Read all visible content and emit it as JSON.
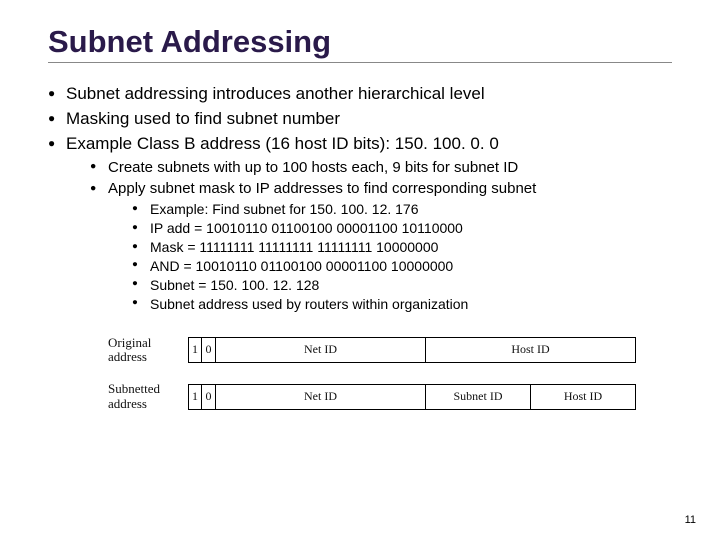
{
  "title": "Subnet Addressing",
  "bullets": {
    "b1": "Subnet addressing introduces another hierarchical level",
    "b2": "Masking used to find subnet number",
    "b3": "Example Class B address (16 host ID bits): 150. 100. 0. 0",
    "b3_1": "Create subnets with up to 100 hosts each, 9 bits for subnet ID",
    "b3_2": "Apply subnet mask to IP addresses to find corresponding subnet",
    "b3_2_1": "Example:  Find subnet for 150. 100. 12. 176",
    "b3_2_2": "IP add = 10010110 01100100 00001100 10110000",
    "b3_2_3": "Mask   = 11111111 11111111 11111111 10000000",
    "b3_2_4": "AND    = 10010110 01100100 00001100 10000000",
    "b3_2_5": "Subnet = 150. 100. 12. 128",
    "b3_2_6": "Subnet address used by routers within organization"
  },
  "diagram": {
    "row1_label": "Original address",
    "row2_label": "Subnetted address",
    "bit1": "1",
    "bit0": "0",
    "netid": "Net ID",
    "hostid": "Host ID",
    "subnetid": "Subnet ID"
  },
  "page_number": "11"
}
